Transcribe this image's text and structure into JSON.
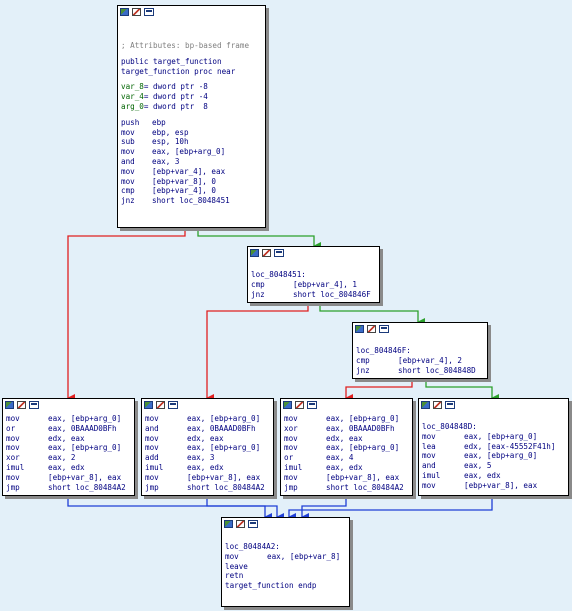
{
  "colors": {
    "background": "#e3f0f9",
    "edge_taken": "#2ca02c",
    "edge_not_taken": "#e02020",
    "edge_unconditional": "#1f3fd6",
    "node_bg": "#ffffff"
  },
  "blocks": {
    "entry": {
      "comment": "; Attributes: bp-based frame",
      "public": "public target_function",
      "proc": "target_function proc near",
      "vars": [
        {
          "name": "var_8",
          "decl": "= dword ptr -8"
        },
        {
          "name": "var_4",
          "decl": "= dword ptr -4"
        },
        {
          "name": "arg_0",
          "decl": "= dword ptr  8"
        }
      ],
      "code": [
        {
          "mnemonic": "push",
          "operand": "ebp"
        },
        {
          "mnemonic": "mov",
          "operand": "ebp, esp"
        },
        {
          "mnemonic": "sub",
          "operand": "esp, 10h"
        },
        {
          "mnemonic": "mov",
          "operand": "eax, [ebp+arg_0]"
        },
        {
          "mnemonic": "and",
          "operand": "eax, 3"
        },
        {
          "mnemonic": "mov",
          "operand": "[ebp+var_4], eax"
        },
        {
          "mnemonic": "mov",
          "operand": "[ebp+var_8], 0"
        },
        {
          "mnemonic": "cmp",
          "operand": "[ebp+var_4], 0"
        },
        {
          "mnemonic": "jnz",
          "operand": "short loc_8048451"
        }
      ]
    },
    "loc_8048451": {
      "label": "loc_8048451:",
      "code": [
        {
          "mnemonic": "cmp",
          "operand": "[ebp+var_4], 1"
        },
        {
          "mnemonic": "jnz",
          "operand": "short loc_804846F"
        }
      ]
    },
    "loc_804846F": {
      "label": "loc_804846F:",
      "code": [
        {
          "mnemonic": "cmp",
          "operand": "[ebp+var_4], 2"
        },
        {
          "mnemonic": "jnz",
          "operand": "short loc_804848D"
        }
      ]
    },
    "case_or": {
      "code": [
        {
          "mnemonic": "mov",
          "operand": "eax, [ebp+arg_0]"
        },
        {
          "mnemonic": "or",
          "operand": "eax, 0BAAAD0BFh"
        },
        {
          "mnemonic": "mov",
          "operand": "edx, eax"
        },
        {
          "mnemonic": "mov",
          "operand": "eax, [ebp+arg_0]"
        },
        {
          "mnemonic": "xor",
          "operand": "eax, 2"
        },
        {
          "mnemonic": "imul",
          "operand": "eax, edx"
        },
        {
          "mnemonic": "mov",
          "operand": "[ebp+var_8], eax"
        },
        {
          "mnemonic": "jmp",
          "operand": "short loc_80484A2"
        }
      ]
    },
    "case_and": {
      "code": [
        {
          "mnemonic": "mov",
          "operand": "eax, [ebp+arg_0]"
        },
        {
          "mnemonic": "and",
          "operand": "eax, 0BAAAD0BFh"
        },
        {
          "mnemonic": "mov",
          "operand": "edx, eax"
        },
        {
          "mnemonic": "mov",
          "operand": "eax, [ebp+arg_0]"
        },
        {
          "mnemonic": "add",
          "operand": "eax, 3"
        },
        {
          "mnemonic": "imul",
          "operand": "eax, edx"
        },
        {
          "mnemonic": "mov",
          "operand": "[ebp+var_8], eax"
        },
        {
          "mnemonic": "jmp",
          "operand": "short loc_80484A2"
        }
      ]
    },
    "case_xor": {
      "code": [
        {
          "mnemonic": "mov",
          "operand": "eax, [ebp+arg_0]"
        },
        {
          "mnemonic": "xor",
          "operand": "eax, 0BAAAD0BFh"
        },
        {
          "mnemonic": "mov",
          "operand": "edx, eax"
        },
        {
          "mnemonic": "mov",
          "operand": "eax, [ebp+arg_0]"
        },
        {
          "mnemonic": "or",
          "operand": "eax, 4"
        },
        {
          "mnemonic": "imul",
          "operand": "eax, edx"
        },
        {
          "mnemonic": "mov",
          "operand": "[ebp+var_8], eax"
        },
        {
          "mnemonic": "jmp",
          "operand": "short loc_80484A2"
        }
      ]
    },
    "loc_804848D": {
      "label": "loc_804848D:",
      "code": [
        {
          "mnemonic": "mov",
          "operand": "eax, [ebp+arg_0]"
        },
        {
          "mnemonic": "lea",
          "operand": "edx, [eax-45552F41h]"
        },
        {
          "mnemonic": "mov",
          "operand": "eax, [ebp+arg_0]"
        },
        {
          "mnemonic": "and",
          "operand": "eax, 5"
        },
        {
          "mnemonic": "imul",
          "operand": "eax, edx"
        },
        {
          "mnemonic": "mov",
          "operand": "[ebp+var_8], eax"
        }
      ]
    },
    "loc_80484A2": {
      "label": "loc_80484A2:",
      "code": [
        {
          "mnemonic": "mov",
          "operand": "eax, [ebp+var_8]"
        },
        {
          "mnemonic": "leave",
          "operand": ""
        },
        {
          "mnemonic": "retn",
          "operand": ""
        }
      ],
      "endp": "target_function endp"
    }
  }
}
